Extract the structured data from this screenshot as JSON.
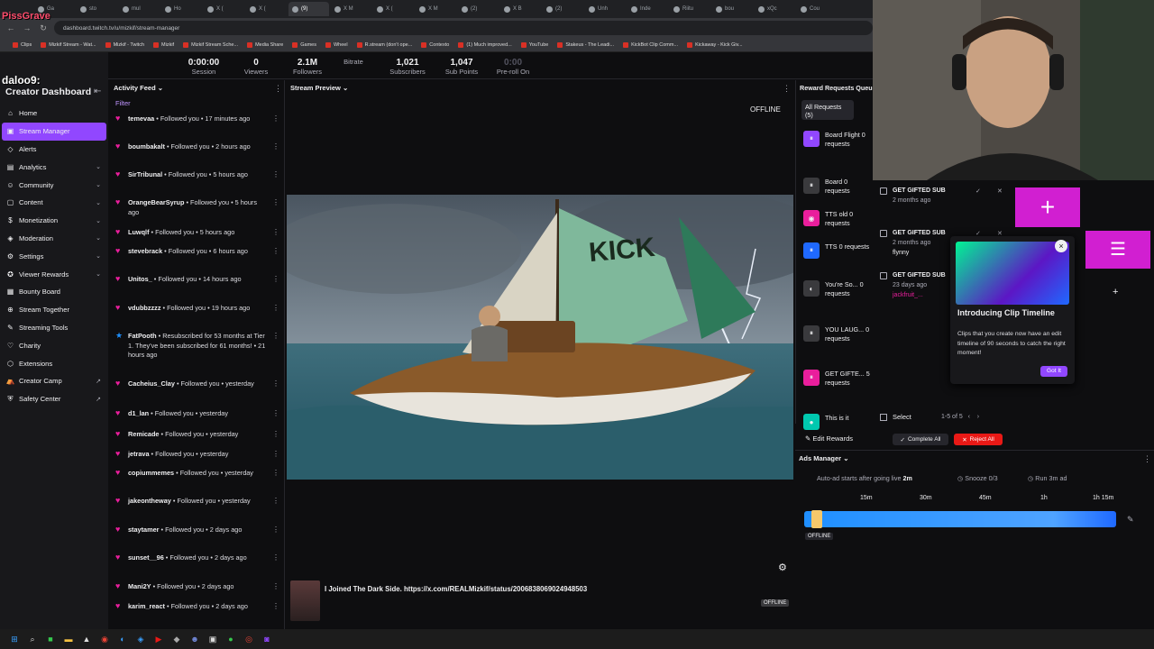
{
  "browser": {
    "tabs": [
      "Ga",
      "sto",
      "mul",
      "Ho",
      "X (",
      "X (",
      "(9) ",
      "X M",
      "X (",
      "X M",
      "(2)",
      "X B",
      "(2)",
      "Unh",
      "Inde",
      "Riitu",
      "bou",
      "xQc",
      "Cou"
    ],
    "url": "dashboard.twitch.tv/u/mizkif/stream-manager",
    "bookmarks": [
      "Clips",
      "Mizkif Stream - Wat...",
      "Mizkif - Twitch",
      "Mizkif",
      "Mizkif Stream Sche...",
      "Media Share",
      "Games",
      "Wheel",
      "R.stream (don't ope...",
      "Contexto",
      "(1) Much improved...",
      "YouTube",
      "Stakeus - The Leadi...",
      "KickBot Clip Comm...",
      "Kickaway - Kick Giv..."
    ]
  },
  "overlay": {
    "top_text": "PissGrave",
    "user_text": "daloo9:"
  },
  "sidebar": {
    "title": "Creator Dashboard",
    "items": [
      {
        "label": "Home",
        "icon": "home-icon",
        "glyph": "⌂",
        "chev": ""
      },
      {
        "label": "Stream Manager",
        "icon": "stream-icon",
        "glyph": "▣",
        "chev": ""
      },
      {
        "label": "Alerts",
        "icon": "alert-icon",
        "glyph": "◇",
        "chev": ""
      },
      {
        "label": "Analytics",
        "icon": "chart-icon",
        "glyph": "▤",
        "chev": "⌄"
      },
      {
        "label": "Community",
        "icon": "people-icon",
        "glyph": "☺",
        "chev": "⌄"
      },
      {
        "label": "Content",
        "icon": "content-icon",
        "glyph": "▢",
        "chev": "⌄"
      },
      {
        "label": "Monetization",
        "icon": "money-icon",
        "glyph": "$",
        "chev": "⌄"
      },
      {
        "label": "Moderation",
        "icon": "shield-icon",
        "glyph": "◈",
        "chev": "⌄"
      },
      {
        "label": "Settings",
        "icon": "gear-icon",
        "glyph": "⚙",
        "chev": "⌄"
      },
      {
        "label": "Viewer Rewards",
        "icon": "reward-icon",
        "glyph": "✪",
        "chev": "⌄"
      },
      {
        "label": "Bounty Board",
        "icon": "bounty-icon",
        "glyph": "▦",
        "chev": ""
      },
      {
        "label": "Stream Together",
        "icon": "together-icon",
        "glyph": "⊕",
        "chev": ""
      },
      {
        "label": "Streaming Tools",
        "icon": "tools-icon",
        "glyph": "✎",
        "chev": ""
      },
      {
        "label": "Charity",
        "icon": "heart-icon",
        "glyph": "♡",
        "chev": ""
      },
      {
        "label": "Extensions",
        "icon": "extension-icon",
        "glyph": "⬡",
        "chev": ""
      },
      {
        "label": "Creator Camp",
        "icon": "camp-icon",
        "glyph": "⛺",
        "chev": "↗"
      },
      {
        "label": "Safety Center",
        "icon": "safety-icon",
        "glyph": "⛨",
        "chev": "↗"
      }
    ]
  },
  "stats": [
    {
      "value": "0:00:00",
      "label": "Session"
    },
    {
      "value": "0",
      "label": "Viewers"
    },
    {
      "value": "2.1M",
      "label": "Followers"
    },
    {
      "value": "",
      "label": "Bitrate"
    },
    {
      "value": "1,021",
      "label": "Subscribers"
    },
    {
      "value": "1,047",
      "label": "Sub Points"
    },
    {
      "value": "0:00",
      "label": "Pre-roll On"
    }
  ],
  "activity": {
    "title": "Activity Feed",
    "filter": "Filter",
    "events": [
      {
        "name": "temevaa",
        "text": " • Followed you • 17 minutes ago",
        "type": "follow"
      },
      {
        "name": "boumbakalt",
        "text": " • Followed you • 2 hours ago",
        "type": "follow"
      },
      {
        "name": "SirTribunal",
        "text": " • Followed you • 5 hours ago",
        "type": "follow"
      },
      {
        "name": "OrangeBearSyrup",
        "text": " • Followed you • 5 hours ago",
        "type": "follow"
      },
      {
        "name": "Luwqlf",
        "text": " • Followed you • 5 hours ago",
        "type": "follow"
      },
      {
        "name": "stevebrack",
        "text": " • Followed you • 6 hours ago",
        "type": "follow"
      },
      {
        "name": "Unitos_",
        "text": " • Followed you • 14 hours ago",
        "type": "follow"
      },
      {
        "name": "vdubbzzzz",
        "text": " • Followed you • 19 hours ago",
        "type": "follow"
      },
      {
        "name": "FatPooth",
        "text": " • Resubscribed for 53 months at Tier 1. They've been subscribed for 61 months! • 21 hours ago",
        "type": "sub"
      },
      {
        "name": "Cacheius_Clay",
        "text": " • Followed you • yesterday",
        "type": "follow"
      },
      {
        "name": "d1_lan",
        "text": " • Followed you • yesterday",
        "type": "follow"
      },
      {
        "name": "Remicade",
        "text": " • Followed you • yesterday",
        "type": "follow"
      },
      {
        "name": "jetrava",
        "text": " • Followed you • yesterday",
        "type": "follow"
      },
      {
        "name": "copiummemes",
        "text": " • Followed you • yesterday",
        "type": "follow"
      },
      {
        "name": "jakeontheway",
        "text": " • Followed you • yesterday",
        "type": "follow"
      },
      {
        "name": "staytamer",
        "text": " • Followed you • 2 days ago",
        "type": "follow"
      },
      {
        "name": "sunset__96",
        "text": " • Followed you • 2 days ago",
        "type": "follow"
      },
      {
        "name": "Mani2Y",
        "text": " • Followed you • 2 days ago",
        "type": "follow"
      },
      {
        "name": "karim_react",
        "text": " • Followed you • 2 days ago",
        "type": "follow"
      }
    ]
  },
  "preview": {
    "title": "Stream Preview",
    "offline": "OFFLINE",
    "stream_title": "I Joined The Dark Side. https://x.com/REALMizkif/status/2006838069024948503",
    "offline_badge": "OFFLINE",
    "sail_text": "KICK"
  },
  "rewards": {
    "title": "Reward Requests Queue",
    "all_requests": "All Requests (5)",
    "items": [
      {
        "text": "Board Flight 0 requests",
        "color": "#9147ff",
        "glyph": "⏸"
      },
      {
        "text": "Board 0 requests",
        "color": "#3a3a3d",
        "glyph": "⏸"
      },
      {
        "text": "TTS old 0 requests",
        "color": "#e91e9c",
        "glyph": "◉"
      },
      {
        "text": "TTS 0 requests",
        "color": "#1f69ff",
        "glyph": "⏸"
      },
      {
        "text": "You're So... 0 requests",
        "color": "#3a3a3d",
        "glyph": "◐"
      },
      {
        "text": "YOU LAUG... 0 requests",
        "color": "#3a3a3d",
        "glyph": "⏸"
      },
      {
        "text": "GET GIFTE... 5 requests",
        "color": "#e91e9c",
        "glyph": "⏸"
      },
      {
        "text": "This is it",
        "color": "#00c8af",
        "glyph": "●"
      }
    ],
    "gifted": [
      {
        "title": "GET GIFTED SUB",
        "date": "2 months ago",
        "user": ""
      },
      {
        "title": "GET GIFTED SUB",
        "date": "2 months ago",
        "user": "flynny"
      },
      {
        "title": "GET GIFTED SUB",
        "date": "23 days ago",
        "user": "jackfruit_..."
      }
    ],
    "select_label": "Select",
    "range": "1-5 of 5",
    "complete": "Complete All",
    "reject": "Reject All",
    "edit": "Edit Rewards"
  },
  "popup": {
    "title": "Introducing Clip Timeline",
    "body": "Clips that you create now have an edit timeline of 90 seconds to catch the right moment!",
    "button": "Got It"
  },
  "ads": {
    "title": "Ads Manager",
    "auto_prefix": "Auto-ad starts after going live ",
    "auto_value": "2m",
    "snooze": "Snooze 0/3",
    "run": "Run 3m ad",
    "ticks": [
      "15m",
      "30m",
      "45m",
      "1h",
      "1h 15m"
    ],
    "status": "OFFLINE"
  },
  "colors": {
    "accent": "#9147ff",
    "follow": "#e91e9c",
    "danger": "#e91916",
    "ads": "#1f8fff"
  }
}
